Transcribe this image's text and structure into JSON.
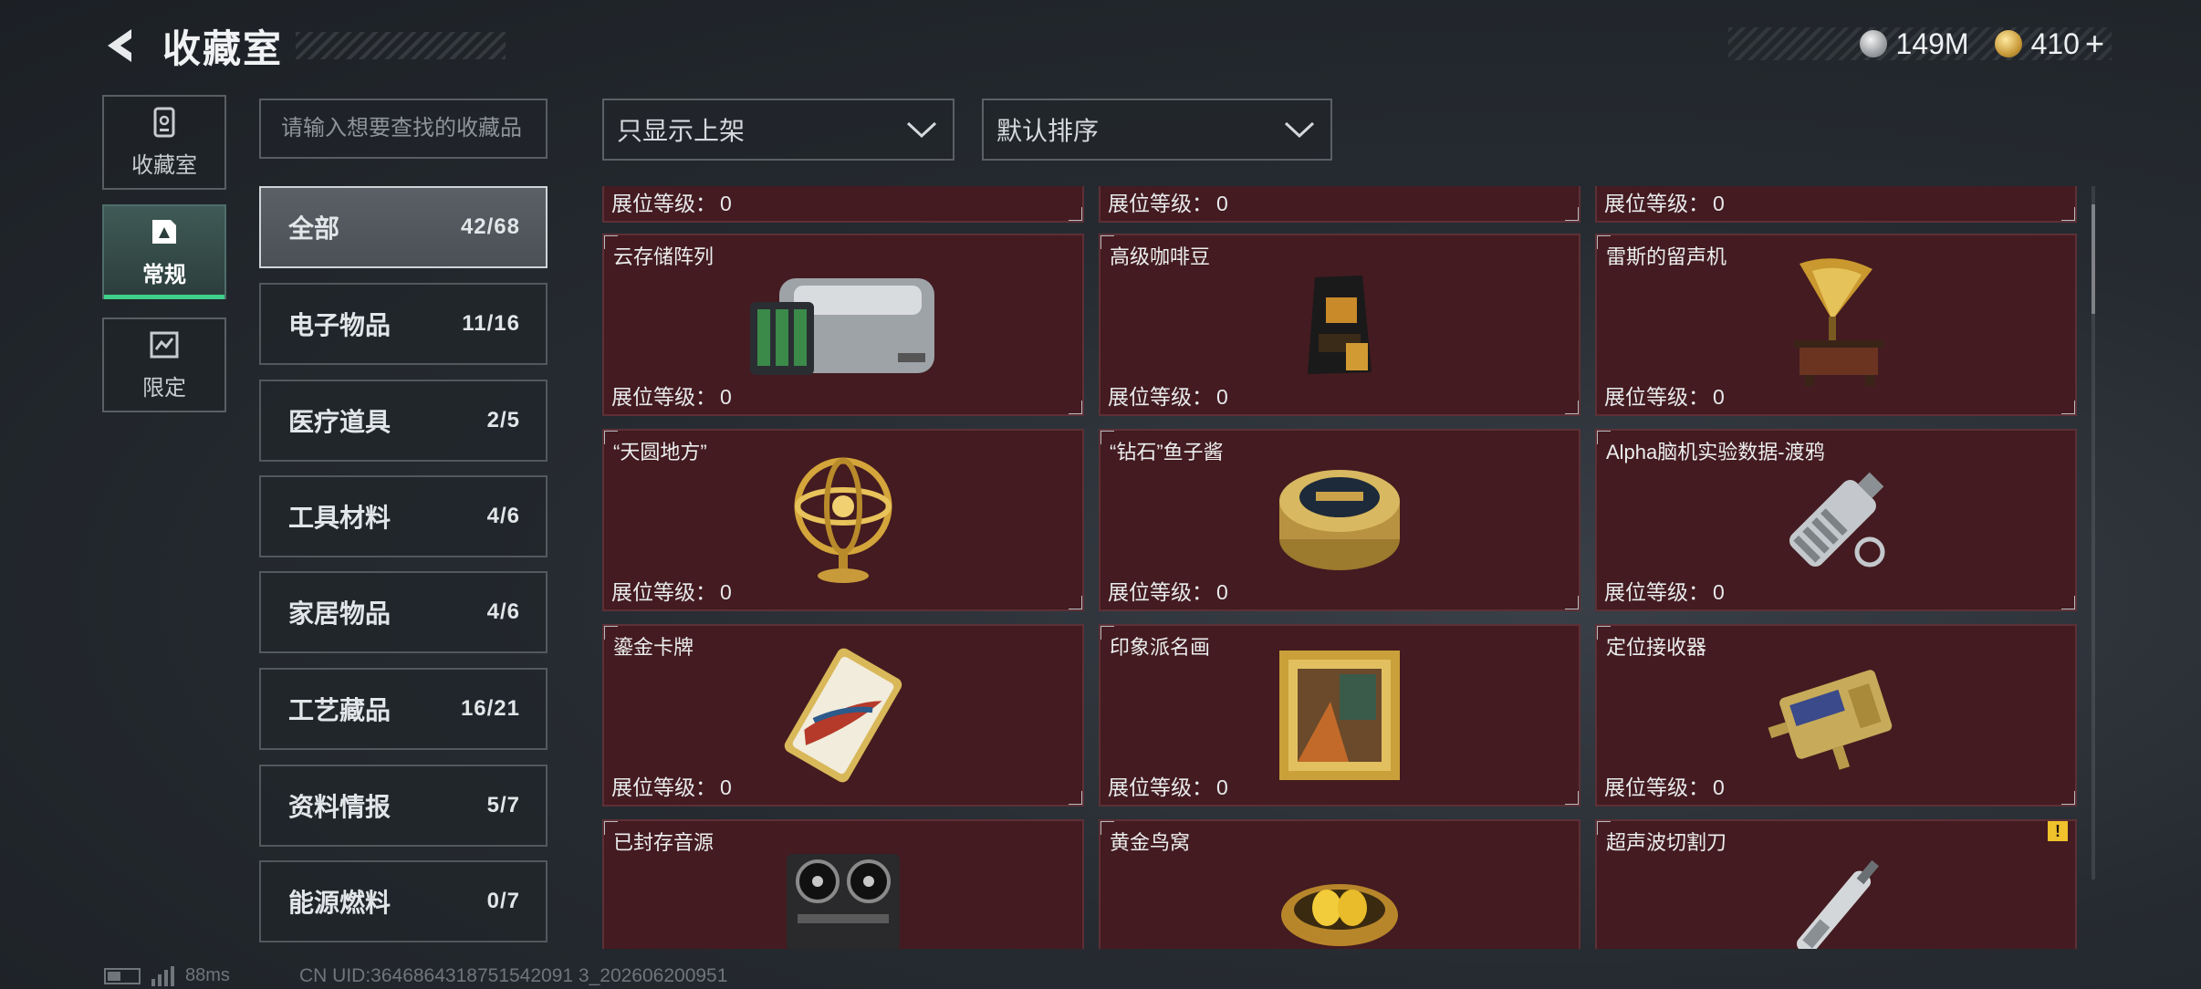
{
  "header": {
    "title": "收藏室",
    "back_icon": "back-arrow-icon"
  },
  "currency": {
    "silver": "149M",
    "gold": "410",
    "plus": "+"
  },
  "side_tabs": [
    {
      "label": "收藏室",
      "icon": "collection-room-icon",
      "active": false
    },
    {
      "label": "常规",
      "icon": "regular-icon",
      "active": true
    },
    {
      "label": "限定",
      "icon": "limited-icon",
      "active": false
    }
  ],
  "search": {
    "placeholder": "请输入想要查找的收藏品"
  },
  "filters": {
    "shelf_filter": "只显示上架",
    "sort": "默认排序"
  },
  "categories": [
    {
      "name": "全部",
      "count": "42/68",
      "active": true
    },
    {
      "name": "电子物品",
      "count": "11/16"
    },
    {
      "name": "医疗道具",
      "count": "2/5"
    },
    {
      "name": "工具材料",
      "count": "4/6"
    },
    {
      "name": "家居物品",
      "count": "4/6"
    },
    {
      "name": "工艺藏品",
      "count": "16/21"
    },
    {
      "name": "资料情报",
      "count": "5/7"
    },
    {
      "name": "能源燃料",
      "count": "0/7"
    }
  ],
  "level_label": "展位等级：",
  "items": [
    {
      "name": "",
      "level": "0",
      "icon": "item-icon"
    },
    {
      "name": "",
      "level": "0",
      "icon": "item-icon"
    },
    {
      "name": "",
      "level": "0",
      "icon": "item-icon"
    },
    {
      "name": "云存储阵列",
      "level": "0",
      "icon": "server-array-icon"
    },
    {
      "name": "高级咖啡豆",
      "level": "0",
      "icon": "coffee-bag-icon"
    },
    {
      "name": "雷斯的留声机",
      "level": "0",
      "icon": "gramophone-icon"
    },
    {
      "name": "“天圆地方”",
      "level": "0",
      "icon": "armillary-sphere-icon"
    },
    {
      "name": "“钻石”鱼子酱",
      "level": "0",
      "icon": "caviar-tin-icon"
    },
    {
      "name": "Alpha脑机实验数据-渡鸦",
      "level": "0",
      "icon": "data-drive-icon"
    },
    {
      "name": "鎏金卡牌",
      "level": "0",
      "icon": "gilded-card-icon"
    },
    {
      "name": "印象派名画",
      "level": "0",
      "icon": "painting-icon"
    },
    {
      "name": "定位接收器",
      "level": "0",
      "icon": "receiver-icon"
    },
    {
      "name": "已封存音源",
      "level": "",
      "icon": "tape-recorder-icon"
    },
    {
      "name": "黄金鸟窝",
      "level": "",
      "icon": "golden-nest-icon"
    },
    {
      "name": "超声波切割刀",
      "level": "",
      "icon": "ultrasonic-cutter-icon",
      "warning": "!"
    }
  ],
  "status": {
    "ping": "88ms",
    "uid": "CN UID:3646864318751542091 3_202606200951"
  },
  "colors": {
    "card_bg": "#431b20",
    "accent_green": "#3fd08a",
    "warning": "#f0c22c"
  }
}
